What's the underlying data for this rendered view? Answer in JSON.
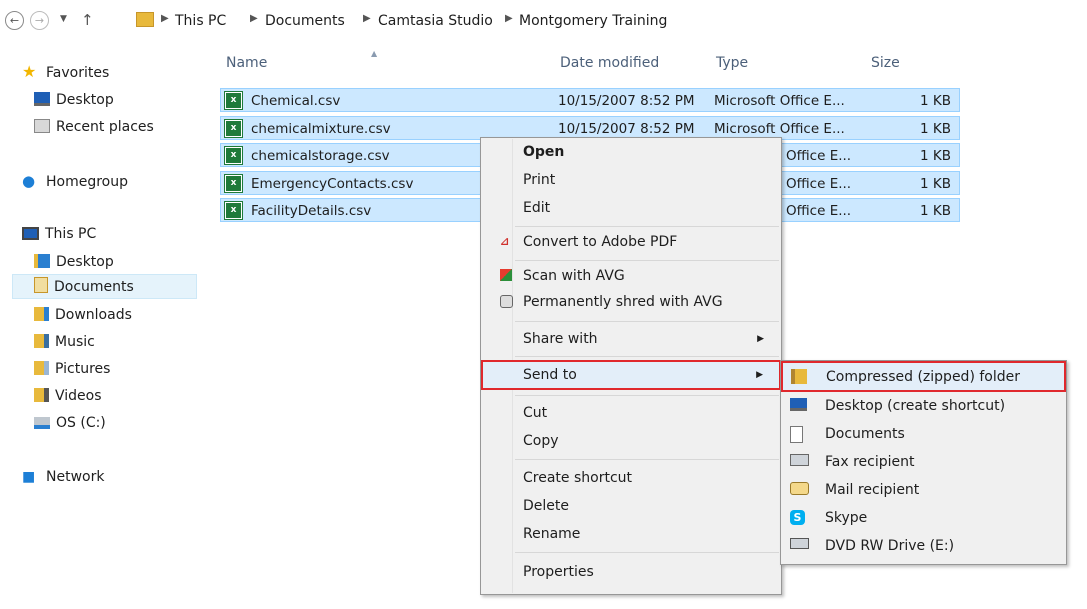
{
  "address": {
    "back_icon": "back-arrow-icon",
    "forward_icon": "forward-arrow-icon",
    "history_icon": "chevron-down-icon",
    "up_icon": "up-arrow-icon",
    "crumbs": [
      "This PC",
      "Documents",
      "Camtasia Studio",
      "Montgomery Training"
    ]
  },
  "sidebar": {
    "favorites": "Favorites",
    "favorites_items": [
      "Desktop",
      "Recent places"
    ],
    "homegroup": "Homegroup",
    "thispc": "This PC",
    "thispc_items": [
      "Desktop",
      "Documents",
      "Downloads",
      "Music",
      "Pictures",
      "Videos",
      "OS (C:)"
    ],
    "network": "Network"
  },
  "columns": {
    "name": "Name",
    "date": "Date modified",
    "type": "Type",
    "size": "Size"
  },
  "files": [
    {
      "name": "Chemical.csv",
      "date": "10/15/2007 8:52 PM",
      "type": "Microsoft Office E...",
      "size": "1 KB"
    },
    {
      "name": "chemicalmixture.csv",
      "date": "10/15/2007 8:52 PM",
      "type": "Microsoft Office E...",
      "size": "1 KB"
    },
    {
      "name": "chemicalstorage.csv",
      "date": "",
      "type": "Office E...",
      "size": "1 KB"
    },
    {
      "name": "EmergencyContacts.csv",
      "date": "",
      "type": "Office E...",
      "size": "1 KB"
    },
    {
      "name": "FacilityDetails.csv",
      "date": "",
      "type": "Office E...",
      "size": "1 KB"
    }
  ],
  "context_menu": {
    "open": "Open",
    "print": "Print",
    "edit": "Edit",
    "convert_pdf": "Convert to Adobe PDF",
    "scan_avg": "Scan with AVG",
    "shred_avg": "Permanently shred with AVG",
    "share_with": "Share with",
    "send_to": "Send to",
    "cut": "Cut",
    "copy": "Copy",
    "create_shortcut": "Create shortcut",
    "delete": "Delete",
    "rename": "Rename",
    "properties": "Properties"
  },
  "send_to_menu": {
    "zip": "Compressed (zipped) folder",
    "desktop": "Desktop (create shortcut)",
    "documents": "Documents",
    "fax": "Fax recipient",
    "mail": "Mail recipient",
    "skype": "Skype",
    "dvd": "DVD RW Drive (E:)"
  },
  "colors": {
    "selection": "#cce8ff",
    "highlight_border": "#e0282d",
    "menu_bg": "#f0f0f0"
  }
}
